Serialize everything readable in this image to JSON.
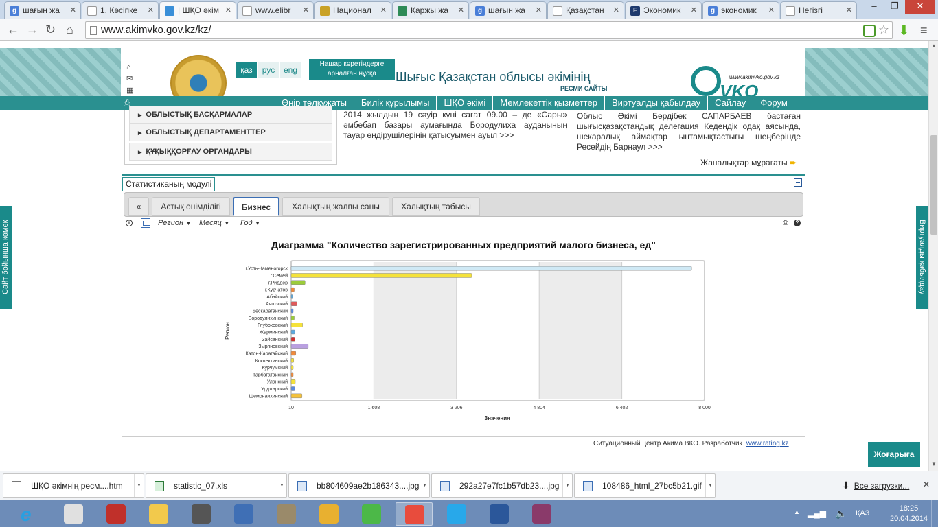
{
  "browser": {
    "tabs": [
      {
        "label": "шағын жа",
        "fav_color": "#4a7fd8",
        "fav_letter": "g",
        "active": false
      },
      {
        "label": "1. Кәсіпке",
        "fav_color": "#ffffff",
        "fav_letter": "",
        "active": false
      },
      {
        "label": "| ШҚО әкім",
        "fav_color": "#3a8fd8",
        "fav_letter": "",
        "active": true
      },
      {
        "label": "www.elibr",
        "fav_color": "#ffffff",
        "fav_letter": "",
        "active": false
      },
      {
        "label": "Национал",
        "fav_color": "#c9a227",
        "fav_letter": "",
        "active": false
      },
      {
        "label": "Қаржы жа",
        "fav_color": "#2e8b57",
        "fav_letter": "",
        "active": false
      },
      {
        "label": "шағын жа",
        "fav_color": "#4a7fd8",
        "fav_letter": "g",
        "active": false
      },
      {
        "label": "Қазақстан",
        "fav_color": "#ffffff",
        "fav_letter": "",
        "active": false
      },
      {
        "label": "Экономик",
        "fav_color": "#1e3a6e",
        "fav_letter": "F",
        "active": false
      },
      {
        "label": "экономик",
        "fav_color": "#4a7fd8",
        "fav_letter": "g",
        "active": false
      },
      {
        "label": "Негізгі",
        "fav_color": "#ffffff",
        "fav_letter": "",
        "active": false
      }
    ],
    "address_host": "www.akimvko.gov.kz",
    "address_path": "/kz/",
    "address": "www.akimvko.gov.kz/kz/"
  },
  "header": {
    "langs": [
      "қаз",
      "рус",
      "eng"
    ],
    "vision_line1": "Нашар көретіндерге",
    "vision_line2": "арналған нұсқа",
    "title": "Шығыс Қазақстан облысы әкімінің",
    "subtitle": "РЕСМИ САЙТЫ",
    "logo_url": "www.akimvko.gov.kz",
    "logo_word": "VKO"
  },
  "nav": {
    "items": [
      "Өңір төлқұжаты",
      "Билік құрылымы",
      "ШҚО әкімі",
      "Мемлекеттік қызметтер",
      "Виртуалды қабылдау",
      "Сайлау",
      "Форум"
    ]
  },
  "sidemenu": [
    "ОБЛЫСТЫҚ БАСҚАРМАЛАР",
    "ОБЛЫСТЫҚ ДЕПАРТАМЕНТТЕР",
    "ҚҰҚЫҚҚОРҒАУ ОРГАНДАРЫ"
  ],
  "news": {
    "left": "2014 жылдың 19 сәуір күні сағат 09.00 – де «Сары» әмбебап базары аумағында Бородулиха ауданының тауар өндірушілерінің қатысуымен ауыл >>>",
    "right": "Облыс Әкімі Бердібек САПАРБАЕВ бастаған шығысқазақстандық делегация Кедендік одақ аясында, шекаралық аймақтар ынтамықтастығы шеңберінде Ресейдің Барнаул >>>",
    "archive": "Жаналықтар мұрағаты"
  },
  "stats": {
    "module_title": "Статистиканың модулі",
    "tabs": [
      "«",
      "Астық өнімділігі",
      "Бизнес",
      "Халықтың жалпы саны",
      "Халықтың табысы"
    ],
    "active_tab": 2,
    "filters": [
      "Регион",
      "Месяц",
      "Год"
    ],
    "credit": "Ситуационный центр Акима ВКО. Разработчик",
    "credit_link": "www.rating.kz"
  },
  "chart_data": {
    "type": "bar",
    "orientation": "horizontal",
    "title": "Диаграмма \"Количество зарегистрированных предприятий малого бизнеса, ед\"",
    "xlabel": "Значения",
    "ylabel": "Регион",
    "xlim": [
      10,
      8000
    ],
    "xticks": [
      "10",
      "1 608",
      "3 206",
      "4 804",
      "6 402",
      "8 000"
    ],
    "grid": true,
    "categories": [
      "г.Усть-Каменогорск",
      "г.Семей",
      "г.Риддер",
      "г.Курчатов",
      "Абайский",
      "Аягозский",
      "Бескарагайский",
      "Бородулихинский",
      "Глубоковский",
      "Жарминский",
      "Зайсанский",
      "Зыряновский",
      "Катон-Карагайский",
      "Кокпектинский",
      "Курчумский",
      "Тарбагатайский",
      "Уланский",
      "Урджарский",
      "Шемонаихинский"
    ],
    "values": [
      7750,
      3500,
      280,
      70,
      20,
      120,
      50,
      70,
      230,
      80,
      80,
      340,
      100,
      60,
      50,
      50,
      90,
      80,
      220
    ],
    "colors": [
      "#cfe9f5",
      "#f5e23a",
      "#9ccc3a",
      "#f08a3c",
      "#5aaae0",
      "#e05a5a",
      "#5a8ae0",
      "#9ccc3a",
      "#f5e23a",
      "#5aaae0",
      "#d03030",
      "#b9a0e0",
      "#f08a3c",
      "#f5e23a",
      "#f5e23a",
      "#f08a3c",
      "#f5e23a",
      "#5a8ae0",
      "#f5c23a"
    ]
  },
  "ribbons": {
    "left": "Сайт бойынша көмек",
    "right": "Виртуалды қабылдау"
  },
  "upbutton": "Жоғарыға",
  "downloads": {
    "items": [
      {
        "name": "ШҚО әкімнің ресм....htm",
        "kind": "doc"
      },
      {
        "name": "statistic_07.xls",
        "kind": "xls"
      },
      {
        "name": "bb804609ae2b186343....jpg",
        "kind": "img"
      },
      {
        "name": "292a27e7fc1b57db23....jpg",
        "kind": "img"
      },
      {
        "name": "108486_html_27bc5b21.gif",
        "kind": "img"
      }
    ],
    "all": "Все загрузки..."
  },
  "taskbar": {
    "apps": [
      {
        "icon": "tiles-icon",
        "color": "#e0e0e0"
      },
      {
        "icon": "power-icon",
        "color": "#c0302a"
      },
      {
        "icon": "folder-icon",
        "color": "#f2c94c"
      },
      {
        "icon": "speaker-icon",
        "color": "#555555"
      },
      {
        "icon": "settings-app-icon",
        "color": "#3f6fb5"
      },
      {
        "icon": "doc-icon",
        "color": "#9a8a6a"
      },
      {
        "icon": "camera-icon",
        "color": "#e8b030"
      },
      {
        "icon": "at-icon",
        "color": "#4cb848"
      },
      {
        "icon": "chrome-icon",
        "color": "#e84c3d"
      },
      {
        "icon": "skype-icon",
        "color": "#28a8ea"
      },
      {
        "icon": "word-icon",
        "color": "#2b579a"
      },
      {
        "icon": "archive-icon",
        "color": "#8a3a6a"
      }
    ],
    "active_index": 8,
    "lang": "ҚАЗ",
    "time": "18:25",
    "date": "20.04.2014"
  }
}
